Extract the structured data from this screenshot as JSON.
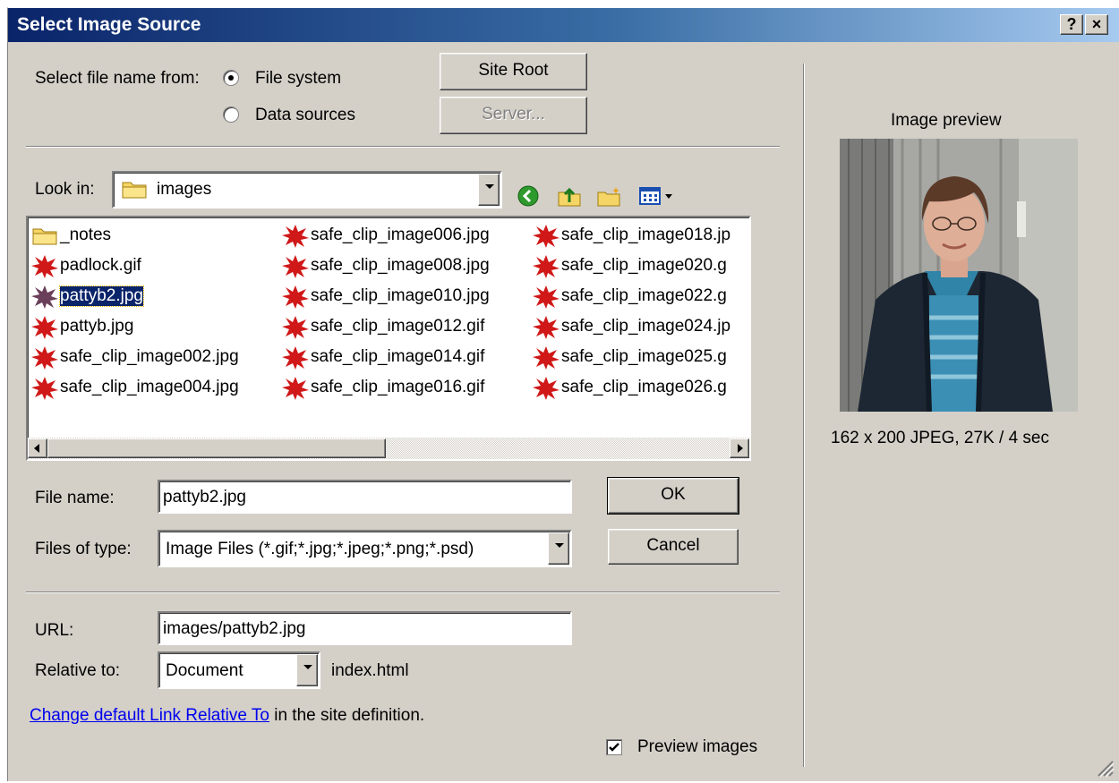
{
  "window": {
    "title": "Select Image Source",
    "help_label": "?",
    "close_label": "×"
  },
  "source": {
    "label": "Select file name from:",
    "options": [
      "File system",
      "Data sources"
    ],
    "selected": "File system",
    "site_root_label": "Site Root",
    "server_label": "Server..."
  },
  "look_in": {
    "label": "Look in:",
    "value": "images"
  },
  "files": [
    {
      "name": "_notes",
      "type": "folder",
      "selected": false
    },
    {
      "name": "padlock.gif",
      "type": "image",
      "selected": false
    },
    {
      "name": "pattyb2.jpg",
      "type": "image",
      "selected": true
    },
    {
      "name": "pattyb.jpg",
      "type": "image",
      "selected": false
    },
    {
      "name": "safe_clip_image002.jpg",
      "type": "image",
      "selected": false
    },
    {
      "name": "safe_clip_image004.jpg",
      "type": "image",
      "selected": false
    },
    {
      "name": "safe_clip_image006.jpg",
      "type": "image",
      "selected": false
    },
    {
      "name": "safe_clip_image008.jpg",
      "type": "image",
      "selected": false
    },
    {
      "name": "safe_clip_image010.jpg",
      "type": "image",
      "selected": false
    },
    {
      "name": "safe_clip_image012.gif",
      "type": "image",
      "selected": false
    },
    {
      "name": "safe_clip_image014.gif",
      "type": "image",
      "selected": false
    },
    {
      "name": "safe_clip_image016.gif",
      "type": "image",
      "selected": false
    },
    {
      "name": "safe_clip_image018.jp",
      "type": "image",
      "selected": false
    },
    {
      "name": "safe_clip_image020.g",
      "type": "image",
      "selected": false
    },
    {
      "name": "safe_clip_image022.g",
      "type": "image",
      "selected": false
    },
    {
      "name": "safe_clip_image024.jp",
      "type": "image",
      "selected": false
    },
    {
      "name": "safe_clip_image025.g",
      "type": "image",
      "selected": false
    },
    {
      "name": "safe_clip_image026.g",
      "type": "image",
      "selected": false
    }
  ],
  "file_name": {
    "label": "File name:",
    "value": "pattyb2.jpg"
  },
  "file_type": {
    "label": "Files of type:",
    "value": "Image Files (*.gif;*.jpg;*.jpeg;*.png;*.psd)"
  },
  "ok_label": "OK",
  "cancel_label": "Cancel",
  "url": {
    "label": "URL:",
    "value": "images/pattyb2.jpg"
  },
  "relative": {
    "label": "Relative to:",
    "value": "Document",
    "page": "index.html"
  },
  "link": {
    "text": "Change default Link Relative To",
    "suffix": "in the site definition."
  },
  "preview_images": {
    "label": "Preview images",
    "checked": true
  },
  "preview": {
    "title": "Image preview",
    "info": "162 x 200 JPEG, 27K / 4 sec"
  },
  "colors": {
    "titlebar": "#0a246a",
    "face": "#d4d0c8",
    "selection": "#0a246a",
    "link": "#0000ee"
  }
}
